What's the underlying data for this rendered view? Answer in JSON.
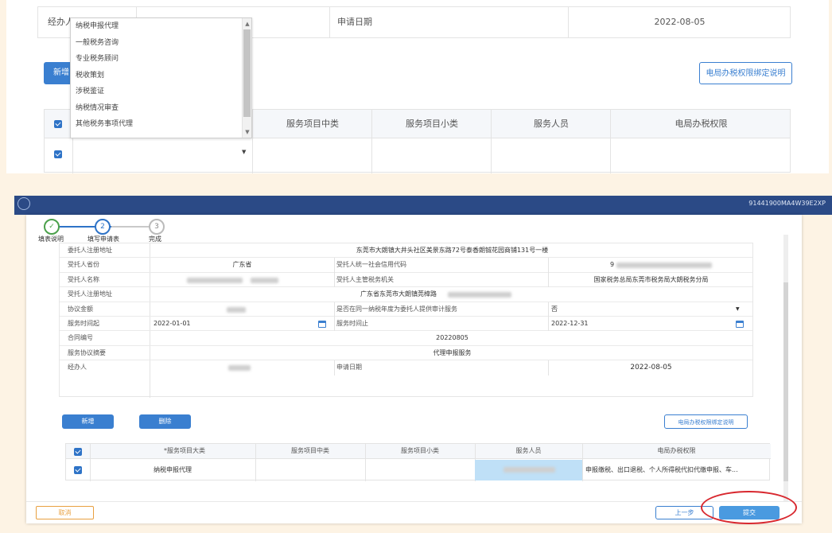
{
  "top": {
    "agent_label": "经办人",
    "date_label": "申请日期",
    "date_value": "2022-08-05",
    "add_button": "新增",
    "auth_button": "电局办税权限绑定说明",
    "dropdown_options": [
      "纳税申报代理",
      "一般税务咨询",
      "专业税务顾问",
      "税收策划",
      "涉税鉴证",
      "纳税情况审查",
      "其他税务事项代理"
    ],
    "table_headers": [
      "服务项目中类",
      "服务项目小类",
      "服务人员",
      "电局办税权限"
    ]
  },
  "bottom": {
    "banner_right_text": "91441900MA4W39E2XP",
    "steps": [
      {
        "num": "✓",
        "label": "填表说明"
      },
      {
        "num": "2",
        "label": "填写申请表"
      },
      {
        "num": "3",
        "label": "完成"
      }
    ],
    "rows": {
      "r0": {
        "label": "委托人注册地址",
        "value": "东莞市大朗镇大井头社区美景东路72号泰香朗铖花园商铺131号一楼"
      },
      "r1": {
        "label": "受托人省份",
        "value": "广东省",
        "label2": "受托人统一社会信用代码",
        "value2": "9"
      },
      "r2": {
        "label": "受托人名称",
        "label2": "受托人主管税务机关",
        "value2": "国家税务总局东莞市税务局大朗税务分局"
      },
      "r3": {
        "label": "受托人注册地址",
        "value": "广东省东莞市大朗镇莞樟路"
      },
      "r4": {
        "label": "协议金额",
        "label2": "是否在同一纳税年度为委托人提供审计服务",
        "value2": "否"
      },
      "r5": {
        "label": "服务时间起",
        "value": "2022-01-01",
        "label2": "服务时间止",
        "value2": "2022-12-31"
      },
      "r6": {
        "label": "合同编号",
        "value": "20220805"
      },
      "r7": {
        "label": "服务协议摘要",
        "value": "代理申报服务"
      },
      "r8": {
        "label": "经办人",
        "label2": "申请日期",
        "value2": "2022-08-05"
      }
    },
    "add_button": "新增",
    "delete_button": "删除",
    "auth_button": "电局办税权限绑定说明",
    "table_headers": [
      "*服务项目大类",
      "服务项目中类",
      "服务项目小类",
      "服务人员",
      "电局办税权限"
    ],
    "table_row": {
      "major": "纳税申报代理",
      "rights": "申报缴税、出口退税、个人所得税代扣代缴申报、车..."
    },
    "cancel_button": "取消",
    "prev_button": "上一步",
    "submit_button": "提交"
  },
  "colors": {
    "primary": "#3a7fd0",
    "highlight": "#bfe0f7",
    "annotation": "#d8282f"
  }
}
